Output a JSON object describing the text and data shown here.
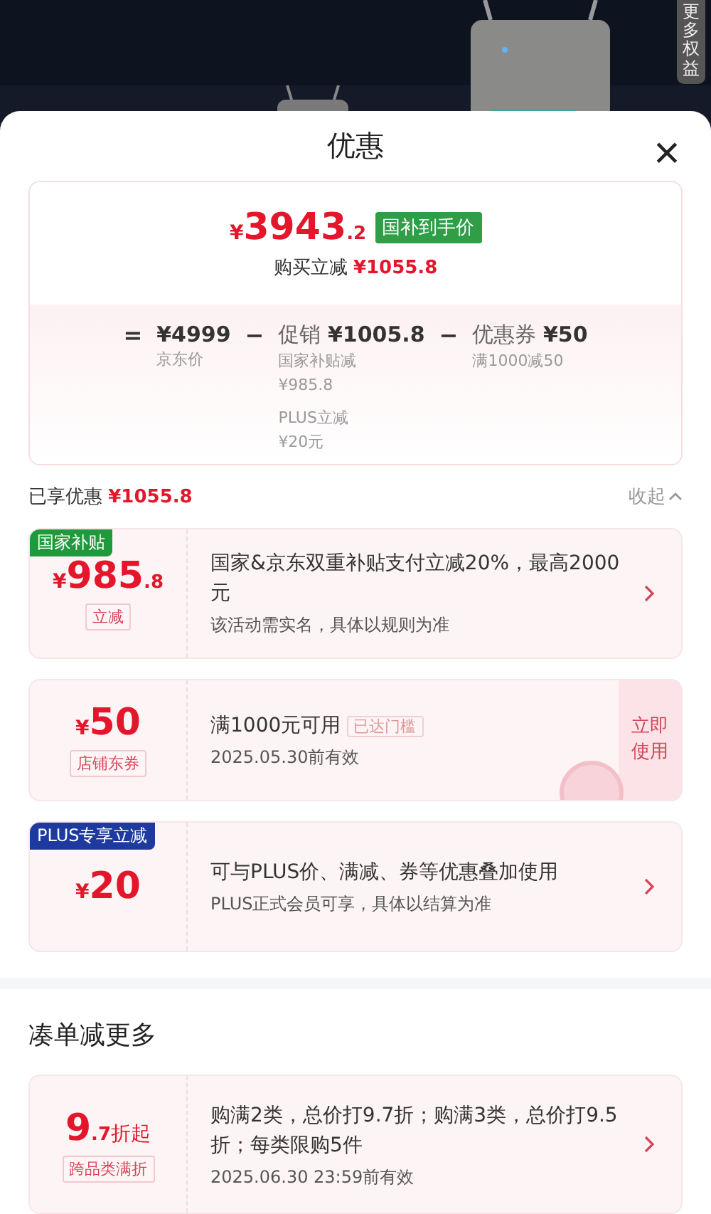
{
  "side_tab": {
    "label": "更多权益"
  },
  "sheet": {
    "title": "优惠",
    "close": "×"
  },
  "summary": {
    "price": {
      "prefix": "¥",
      "main": "3943",
      "fraction": ".2"
    },
    "price_tag": "国补到手价",
    "saving_label": "购买立减",
    "saving_value": "¥1055.8",
    "terms": [
      {
        "op": "=",
        "amount": "¥4999",
        "notes": [
          "京东价"
        ]
      },
      {
        "op": "−",
        "name": "促销",
        "amount": "¥1005.8",
        "notes": [
          "国家补贴减",
          "¥985.8",
          "PLUS立减",
          "¥20元"
        ]
      },
      {
        "op": "−",
        "name": "优惠券",
        "amount": "¥50",
        "notes": [
          "满1000减50"
        ]
      }
    ]
  },
  "enjoyed": {
    "label": "已享优惠",
    "value": "¥1055.8",
    "toggle": "收起",
    "expanded": true
  },
  "offers": [
    {
      "kind": "arrow",
      "badge": "国家补贴",
      "color": "#1e9a3c",
      "amount": {
        "prefix": "¥",
        "main": "985",
        "fraction": ".8"
      },
      "tag": "立减",
      "title": "国家&京东双重补贴支付立减20%，最高2000元",
      "detail": "该活动需实名，具体以规则为准"
    },
    {
      "kind": "action",
      "amount": {
        "prefix": "¥",
        "main": "50"
      },
      "tag": "店铺东券",
      "title": "满1000元可用",
      "status": "已达门槛",
      "detail": "2025.05.30前有效",
      "action": "立即使用"
    },
    {
      "kind": "arrow",
      "badge": "PLUS专享立减",
      "color": "#1f3a9e",
      "amount": {
        "prefix": "¥",
        "main": "20"
      },
      "title": "可与PLUS价、满减、券等优惠叠加使用",
      "detail": "PLUS正式会员可享，具体以结算为准"
    }
  ],
  "more": {
    "title": "凑单减更多",
    "offers": [
      {
        "kind": "arrow",
        "amount": {
          "main": "9",
          "fraction": ".7",
          "suffix": "折起"
        },
        "tag": "跨品类满折",
        "title": "购满2类，总价打9.7折；购满3类，总价打9.5折；每类限购5件",
        "detail": "2025.06.30 23:59前有效"
      }
    ]
  }
}
